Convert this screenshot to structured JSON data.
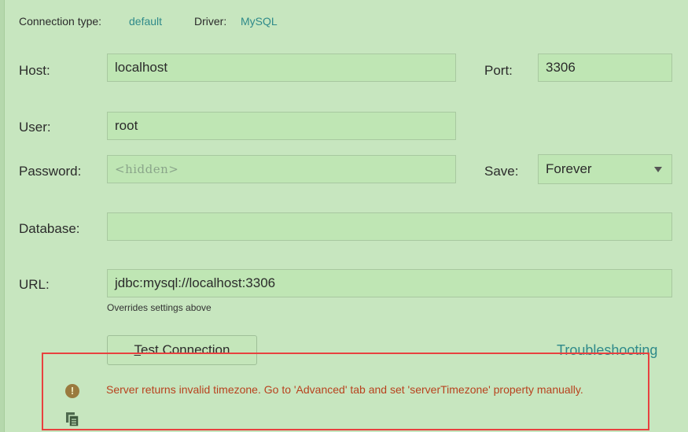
{
  "header": {
    "connection_type_label": "Connection type:",
    "connection_type_value": "default",
    "driver_label": "Driver:",
    "driver_value": "MySQL"
  },
  "form": {
    "host_label": "Host:",
    "host_value": "localhost",
    "port_label": "Port:",
    "port_value": "3306",
    "user_label": "User:",
    "user_value": "root",
    "password_label": "Password:",
    "password_placeholder": "<hidden>",
    "save_label": "Save:",
    "save_value": "Forever",
    "database_label": "Database:",
    "database_value": "",
    "url_label": "URL:",
    "url_value": "jdbc:mysql://localhost:3306",
    "url_hint": "Overrides settings above"
  },
  "actions": {
    "test_connection_mnemonic": "T",
    "test_connection_rest": "est Connection",
    "troubleshooting": "Troubleshooting"
  },
  "error": {
    "message": "Server returns invalid timezone. Go to 'Advanced' tab and set 'serverTimezone' property manually."
  },
  "icons": {
    "warning": "warning-icon",
    "copy": "copy-icon",
    "dropdown": "chevron-down-icon"
  },
  "colors": {
    "background": "#c7e6bf",
    "link": "#2f8a8a",
    "error_text": "#b8421e",
    "highlight_border": "#e8413f"
  }
}
